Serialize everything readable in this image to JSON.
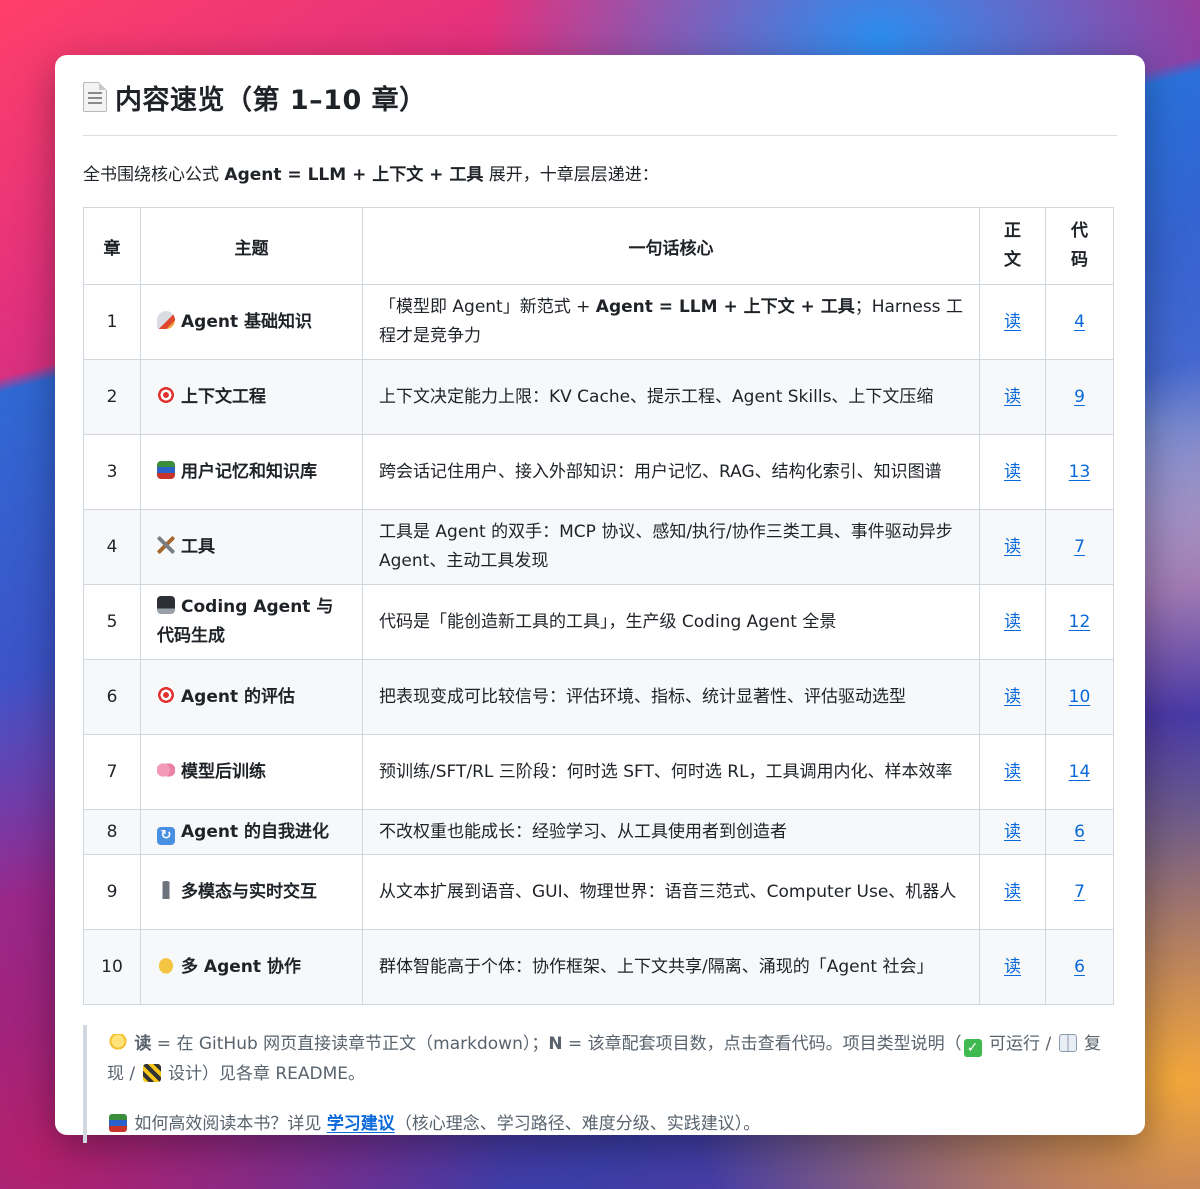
{
  "header": {
    "title_icon": "document-icon",
    "title": "内容速览（第 1–10 章）"
  },
  "intro": {
    "prefix": "全书围绕核心公式 ",
    "formula": "Agent = LLM + 上下文 + 工具",
    "suffix": " 展开，十章层层递进："
  },
  "table": {
    "headers": [
      "章",
      "主题",
      "一句话核心",
      "正文",
      "代码"
    ],
    "rows": [
      {
        "num": "1",
        "icon": "rocket-icon",
        "topic": "Agent 基础知识",
        "core_pre": "「模型即 Agent」新范式 + ",
        "core_bold": "Agent = LLM + 上下文 + 工具",
        "core_post": "；Harness 工程才是竞争力",
        "read": "读",
        "code": "4"
      },
      {
        "num": "2",
        "icon": "target-icon",
        "topic": "上下文工程",
        "core_pre": "上下文决定能力上限：KV Cache、提示工程、Agent Skills、上下文压缩",
        "core_bold": "",
        "core_post": "",
        "read": "读",
        "code": "9"
      },
      {
        "num": "3",
        "icon": "books-icon",
        "topic": "用户记忆和知识库",
        "core_pre": "跨会话记住用户、接入外部知识：用户记忆、RAG、结构化索引、知识图谱",
        "core_bold": "",
        "core_post": "",
        "read": "读",
        "code": "13"
      },
      {
        "num": "4",
        "icon": "tools-icon",
        "topic": "工具",
        "core_pre": "工具是 Agent 的双手：MCP 协议、感知/执行/协作三类工具、事件驱动异步 Agent、主动工具发现",
        "core_bold": "",
        "core_post": "",
        "read": "读",
        "code": "7"
      },
      {
        "num": "5",
        "icon": "laptop-icon",
        "topic": "Coding Agent 与代码生成",
        "core_pre": "代码是「能创造新工具的工具」，生产级 Coding Agent 全景",
        "core_bold": "",
        "core_post": "",
        "read": "读",
        "code": "12"
      },
      {
        "num": "6",
        "icon": "target-icon",
        "topic": "Agent 的评估",
        "core_pre": "把表现变成可比较信号：评估环境、指标、统计显著性、评估驱动选型",
        "core_bold": "",
        "core_post": "",
        "read": "读",
        "code": "10"
      },
      {
        "num": "7",
        "icon": "brain-icon",
        "topic": "模型后训练",
        "core_pre": "预训练/SFT/RL 三阶段：何时选 SFT、何时选 RL，工具调用内化、样本效率",
        "core_bold": "",
        "core_post": "",
        "read": "读",
        "code": "14"
      },
      {
        "num": "8",
        "icon": "refresh-icon",
        "topic": "Agent 的自我进化",
        "core_pre": "不改权重也能成长：经验学习、从工具使用者到创造者",
        "core_bold": "",
        "core_post": "",
        "read": "读",
        "code": "6"
      },
      {
        "num": "9",
        "icon": "microphone-icon",
        "topic": "多模态与实时交互",
        "core_pre": "从文本扩展到语音、GUI、物理世界：语音三范式、Computer Use、机器人",
        "core_bold": "",
        "core_post": "",
        "read": "读",
        "code": "7"
      },
      {
        "num": "10",
        "icon": "handshake-icon",
        "topic": "多 Agent 协作",
        "core_pre": "群体智能高于个体：协作框架、上下文共享/隔离、涌现的「Agent 社会」",
        "core_bold": "",
        "core_post": "",
        "read": "读",
        "code": "6"
      }
    ]
  },
  "notes": {
    "line1_read_key": "读",
    "line1_a": " = 在 GitHub 网页直接读章节正文（markdown）；",
    "line1_n_key": "N",
    "line1_b": " = 该章配套项目数，点击查看代码。项目类型说明（",
    "line1_c": " 可运行 / ",
    "line1_d": " 复现 / ",
    "line1_e": " 设计）见各章 README。",
    "line2_a": " 如何高效阅读本书？详见 ",
    "line2_link": "学习建议",
    "line2_b": "（核心理念、学习路径、难度分级、实践建议）。"
  },
  "colors": {
    "link": "#0969da",
    "border": "#d0d7de",
    "stripe": "#f6f8fa",
    "text": "#1f2328",
    "muted": "#59636e"
  }
}
